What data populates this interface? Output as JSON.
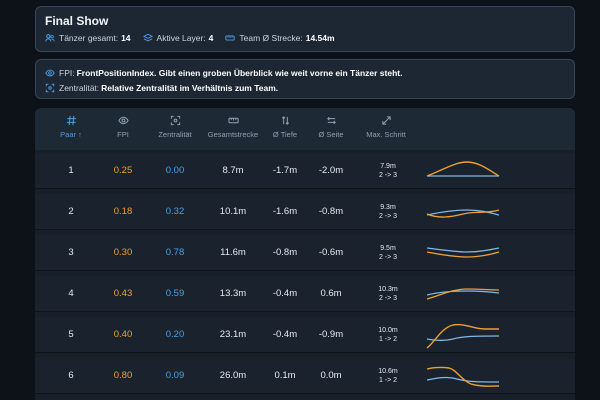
{
  "header": {
    "title": "Final Show",
    "stats": [
      {
        "label": "Tänzer gesamt:",
        "value": "14",
        "icon": "users-icon"
      },
      {
        "label": "Aktive Layer:",
        "value": "4",
        "icon": "layers-icon"
      },
      {
        "label": "Team Ø Strecke:",
        "value": "14.54m",
        "icon": "ruler-icon"
      }
    ]
  },
  "info": {
    "fpi_label": "FPI:",
    "fpi_text": "FrontPositionIndex. Gibt einen groben Überblick wie weit vorne ein Tänzer steht.",
    "zentral_label": "Zentralität:",
    "zentral_text": "Relative Zentralität im Verhältnis zum Team."
  },
  "columns": {
    "paar": "Paar ↑",
    "fpi": "FPI",
    "zentralitaet": "Zentralität",
    "gesamtstrecke": "Gesamtstrecke",
    "tiefe": "Ø Tiefe",
    "seite": "Ø Seite",
    "max_schritt": "Max. Schritt"
  },
  "rows": [
    {
      "paar": "1",
      "fpi": "0.25",
      "zen": "0.00",
      "strecke": "8.7m",
      "tiefe": "-1.7m",
      "seite": "-2.0m",
      "step_dist": "7.9m",
      "step_range": "2 -> 3"
    },
    {
      "paar": "2",
      "fpi": "0.18",
      "zen": "0.32",
      "strecke": "10.1m",
      "tiefe": "-1.6m",
      "seite": "-0.8m",
      "step_dist": "9.3m",
      "step_range": "2 -> 3"
    },
    {
      "paar": "3",
      "fpi": "0.30",
      "zen": "0.78",
      "strecke": "11.6m",
      "tiefe": "-0.8m",
      "seite": "-0.6m",
      "step_dist": "9.5m",
      "step_range": "2 -> 3"
    },
    {
      "paar": "4",
      "fpi": "0.43",
      "zen": "0.59",
      "strecke": "13.3m",
      "tiefe": "-0.4m",
      "seite": "0.6m",
      "step_dist": "10.3m",
      "step_range": "2 -> 3"
    },
    {
      "paar": "5",
      "fpi": "0.40",
      "zen": "0.20",
      "strecke": "23.1m",
      "tiefe": "-0.4m",
      "seite": "-0.9m",
      "step_dist": "10.0m",
      "step_range": "1 -> 2"
    },
    {
      "paar": "6",
      "fpi": "0.80",
      "zen": "0.09",
      "strecke": "26.0m",
      "tiefe": "0.1m",
      "seite": "0.0m",
      "step_dist": "10.6m",
      "step_range": "1 -> 2"
    }
  ],
  "colors": {
    "accent": "#4f9ee8",
    "fpi": "#f0a030",
    "zentralitaet": "#4aa0e6",
    "spark_orange": "#f0a030",
    "spark_blue": "#7fb8ea"
  }
}
